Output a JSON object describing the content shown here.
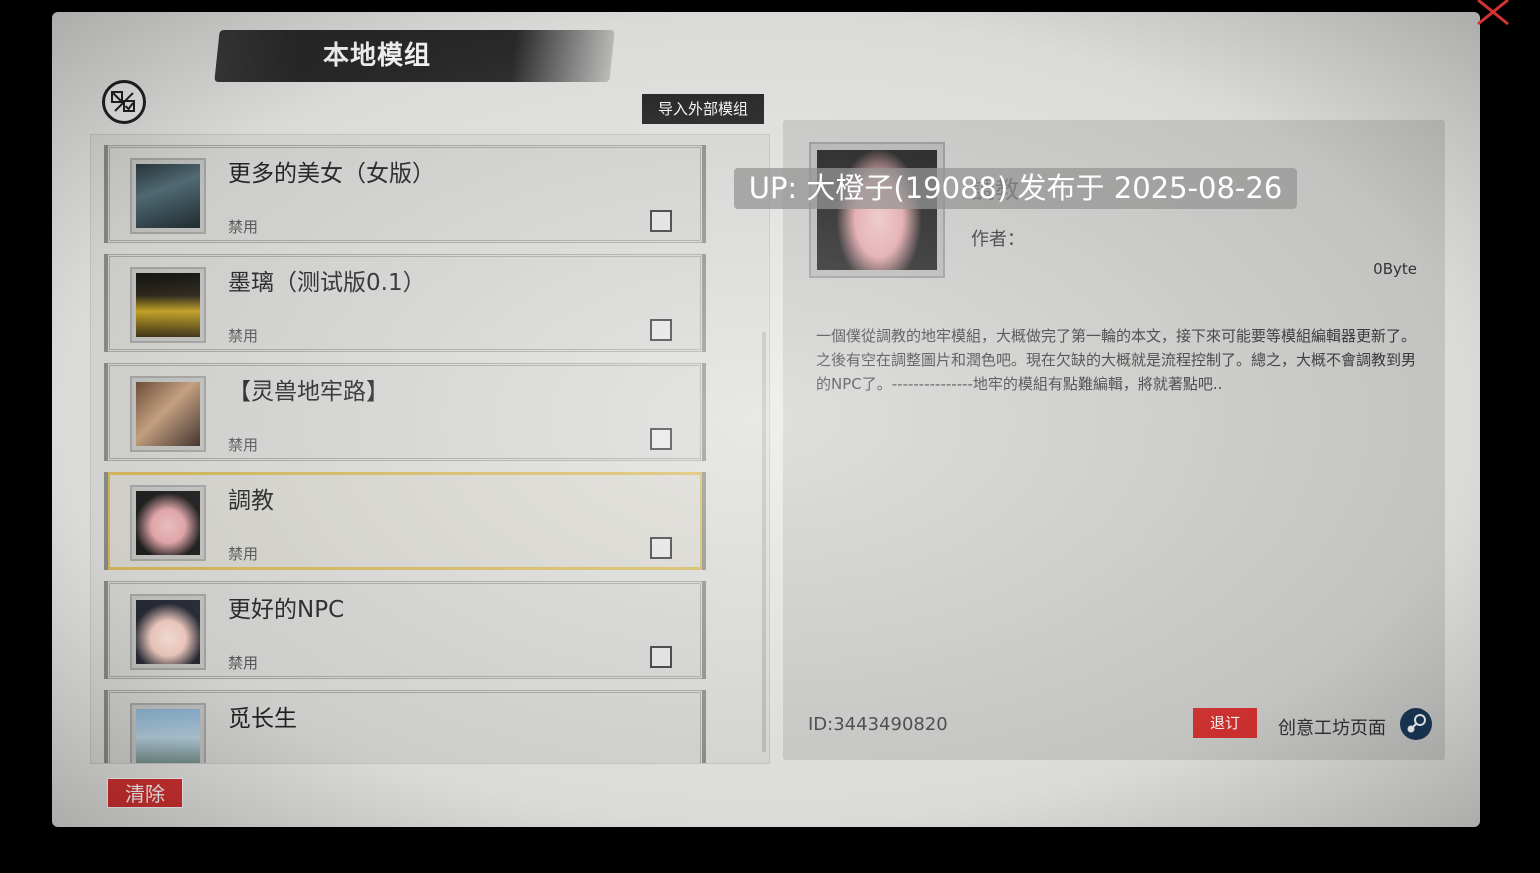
{
  "header": {
    "title": "本地模组",
    "import_label": "导入外部模组",
    "toggle_icon": "toggle-mods-icon",
    "close_icon": "close-icon"
  },
  "mods": [
    {
      "name": "更多的美女（女版）",
      "status": "禁用",
      "selected": false
    },
    {
      "name": "墨璃（测试版0.1）",
      "status": "禁用",
      "selected": false
    },
    {
      "name": "【灵兽地牢路】",
      "status": "禁用",
      "selected": false
    },
    {
      "name": "調教",
      "status": "禁用",
      "selected": true
    },
    {
      "name": "更好的NPC",
      "status": "禁用",
      "selected": false
    },
    {
      "name": "觅长生",
      "status": "",
      "selected": false
    }
  ],
  "footer": {
    "clear_label": "清除"
  },
  "detail": {
    "title": "調教",
    "author": "作者：",
    "size": "0Byte",
    "description": "一個僕從調教的地牢模組，大概做完了第一輪的本文，接下來可能要等模組編輯器更新了。之後有空在調整圖片和潤色吧。現在欠缺的大概就是流程控制了。總之，大概不會調教到男的NPC了。---------------地牢的模組有點難編輯，將就著點吧..",
    "id": "ID:3443490820",
    "unsubscribe_label": "退订",
    "workshop_label": "创意工坊页面"
  },
  "overlay": {
    "text": "UP: 大橙子(19088) 发布于 2025-08-26"
  },
  "colors": {
    "accent_red": "#d63232",
    "selected_border": "#d8b95a",
    "paper": "#e6e6e4"
  }
}
